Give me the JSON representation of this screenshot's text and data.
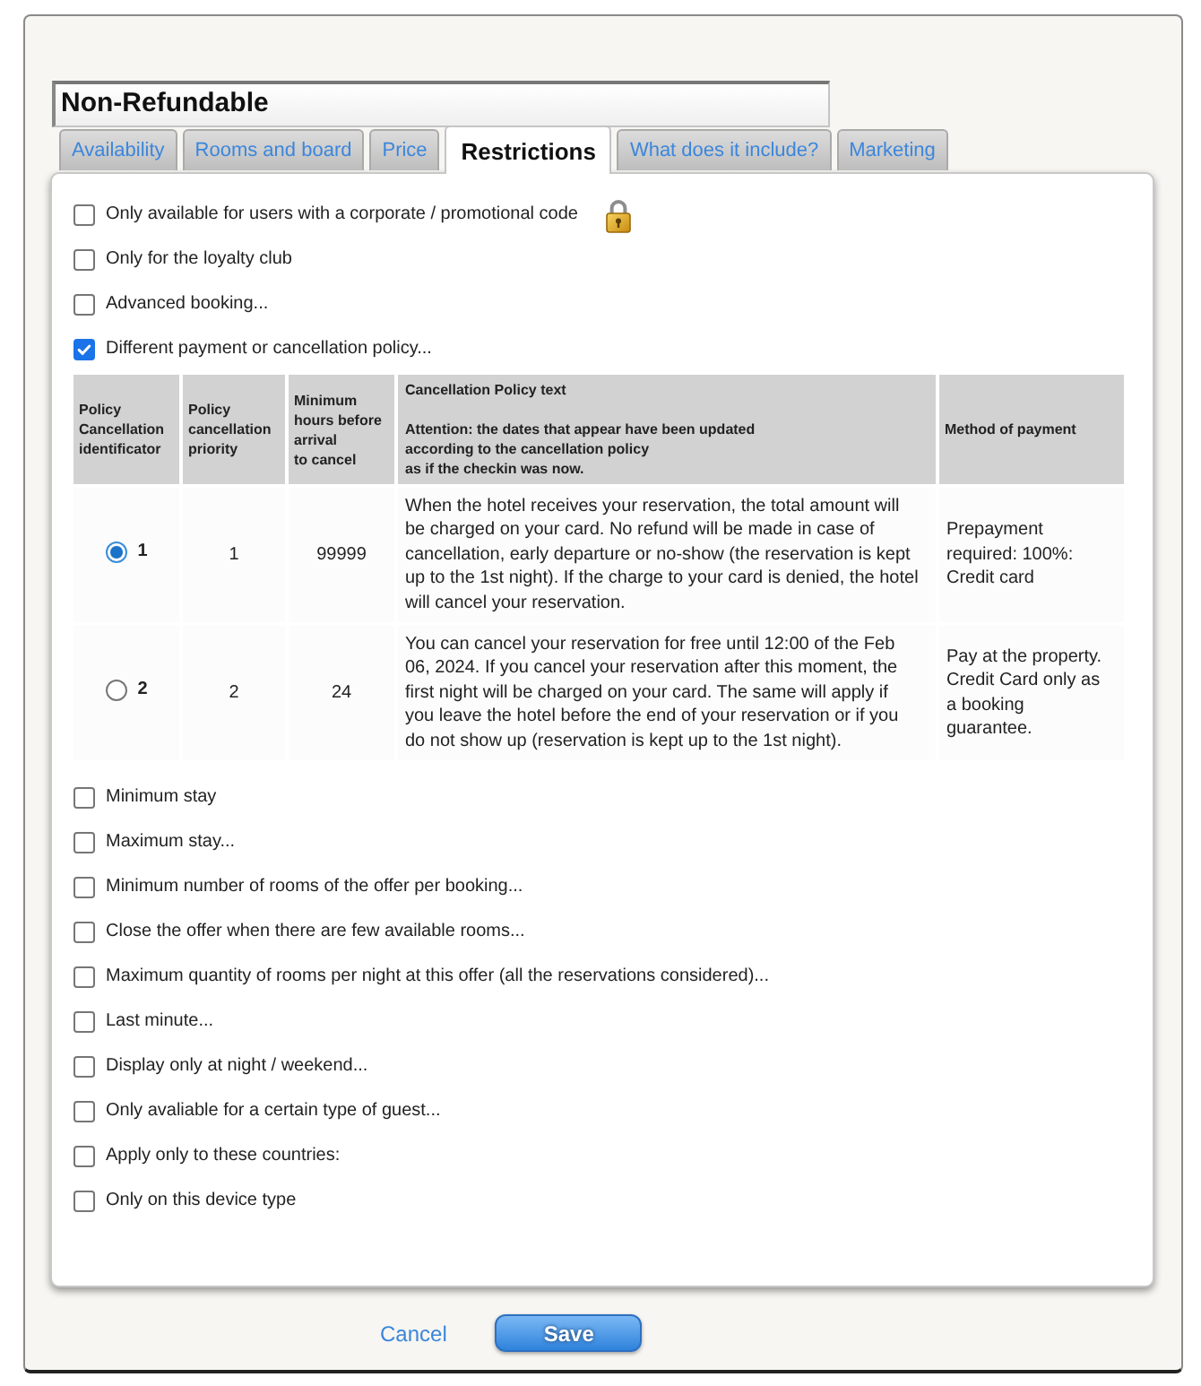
{
  "title_field": {
    "value": "Non-Refundable"
  },
  "tabs": [
    {
      "label": "Availability",
      "selected": false
    },
    {
      "label": "Rooms and board",
      "selected": false
    },
    {
      "label": "Price",
      "selected": false
    },
    {
      "label": "Restrictions",
      "selected": true
    },
    {
      "label": "What does it include?",
      "selected": false
    },
    {
      "label": "Marketing",
      "selected": false
    }
  ],
  "options": [
    {
      "label": "Only available for users with a corporate / promotional code",
      "checked": false,
      "locked": true
    },
    {
      "label": "Only for the loyalty club",
      "checked": false,
      "locked": false
    },
    {
      "label": "Advanced booking...",
      "checked": false,
      "locked": false
    },
    {
      "label": "Different payment or cancellation policy...",
      "checked": true,
      "locked": false,
      "policies": {
        "columns": [
          {
            "label": "Policy Cancellation identificator"
          },
          {
            "label": "Policy cancellation priority"
          },
          {
            "label": "Minimum hours before arrival\nto cancel"
          },
          {
            "label": "Cancellation Policy text",
            "note": "Attention: the dates that appear have been updated\naccording to the cancellation policy\nas if the checkin was now."
          },
          {
            "label": "Method of payment"
          }
        ],
        "rows": [
          {
            "selected": true,
            "id": "1",
            "priority": "1",
            "min_hours": "99999",
            "policy_text": "When the hotel receives your reservation, the total amount will be charged on your card. No refund will be made in case of cancellation, early departure or no-show (the reservation is kept up to the 1st night). If the charge to your card is denied, the hotel will cancel your reservation.",
            "payment": "Prepayment required: 100%: Credit card"
          },
          {
            "selected": false,
            "id": "2",
            "priority": "2",
            "min_hours": "24",
            "policy_text": "You can cancel your reservation for free until 12:00 of the Feb 06, 2024. If you cancel your reservation after this moment, the first night will be charged on your card. The same will apply if you leave the hotel before the end of your reservation or if you do not show up (reservation is kept up to the 1st night).",
            "payment": "Pay at the property. Credit Card only as a booking guarantee."
          }
        ]
      }
    },
    {
      "label": "Minimum stay",
      "checked": false,
      "locked": false
    },
    {
      "label": "Maximum stay...",
      "checked": false,
      "locked": false
    },
    {
      "label": "Minimum number of rooms of the offer per booking...",
      "checked": false,
      "locked": false
    },
    {
      "label": "Close the offer when there are few available rooms...",
      "checked": false,
      "locked": false
    },
    {
      "label": "Maximum quantity of rooms per night at this offer (all the reservations considered)...",
      "checked": false,
      "locked": false
    },
    {
      "label": "Last minute...",
      "checked": false,
      "locked": false
    },
    {
      "label": "Display only at night / weekend...",
      "checked": false,
      "locked": false
    },
    {
      "label": "Only avaliable for a certain type of guest...",
      "checked": false,
      "locked": false
    },
    {
      "label": "Apply only to these countries:",
      "checked": false,
      "locked": false
    },
    {
      "label": "Only on this device type",
      "checked": false,
      "locked": false
    }
  ],
  "footer": {
    "cancel": "Cancel",
    "save": "Save"
  }
}
